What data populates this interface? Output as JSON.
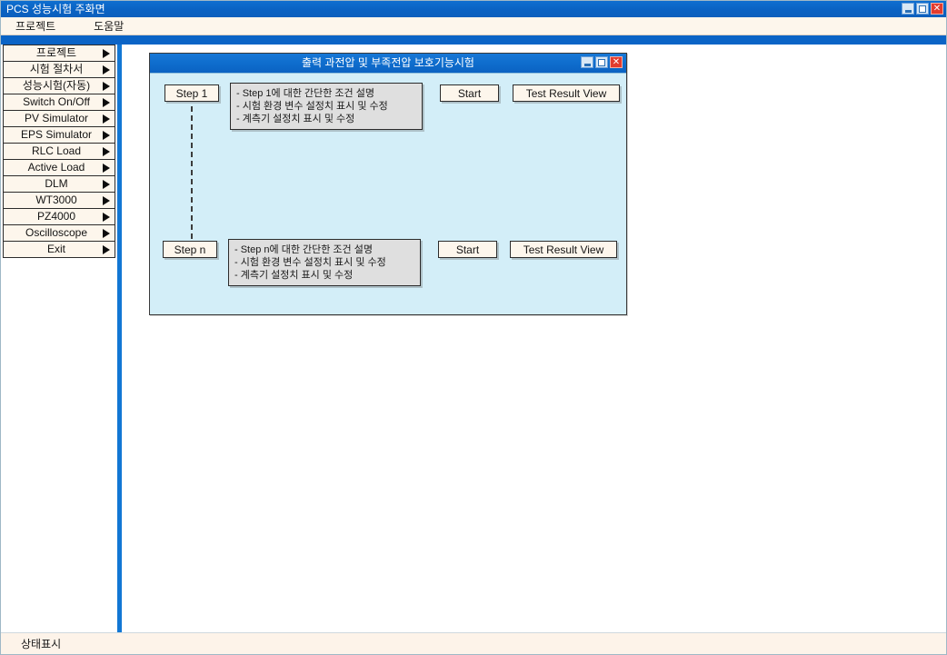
{
  "window": {
    "title": "PCS 성능시험 주화면",
    "controls": [
      {
        "name": "minimize",
        "glyph": "_"
      },
      {
        "name": "maximize",
        "glyph": "□"
      },
      {
        "name": "close",
        "glyph": "✕"
      }
    ]
  },
  "menubar": {
    "items": [
      {
        "label": "프로젝트"
      },
      {
        "label": "도움말"
      }
    ]
  },
  "sidebar": {
    "items": [
      {
        "label": "프로젝트",
        "arrow": "▶"
      },
      {
        "label": "시험 절차서",
        "arrow": "▶"
      },
      {
        "label": "성능시험(자동)",
        "arrow": "▶"
      },
      {
        "label": "Switch On/Off",
        "arrow": "▶"
      },
      {
        "label": "PV Simulator",
        "arrow": "▶"
      },
      {
        "label": "EPS Simulator",
        "arrow": "▶"
      },
      {
        "label": "RLC Load",
        "arrow": "▶"
      },
      {
        "label": "Active Load",
        "arrow": "▶"
      },
      {
        "label": "DLM",
        "arrow": "▶"
      },
      {
        "label": "WT3000",
        "arrow": "▶"
      },
      {
        "label": "PZ4000",
        "arrow": "▶"
      },
      {
        "label": "Oscilloscope",
        "arrow": "▶"
      },
      {
        "label": "Exit",
        "arrow": "▶"
      }
    ]
  },
  "dialog": {
    "title": "출력 과전압 및 부족전압 보호기능시험",
    "controls": [
      {
        "name": "minimize",
        "glyph": "_"
      },
      {
        "name": "maximize",
        "glyph": "□"
      },
      {
        "name": "close",
        "glyph": "✕"
      }
    ],
    "steps": [
      {
        "step_label": "Step 1",
        "description": [
          "- Step 1에 대한 간단한 조건 설명",
          "- 시험 환경 변수 설정치 표시 및 수정",
          "- 계측기 설정치 표시 및 수정"
        ],
        "start_label": "Start",
        "result_label": "Test Result View"
      },
      {
        "step_label": "Step n",
        "description": [
          "- Step n에 대한 간단한 조건 설명",
          "- 시험 환경 변수 설정치 표시 및 수정",
          "- 계측기 설정치 표시 및 수정"
        ],
        "start_label": "Start",
        "result_label": "Test Result View"
      }
    ]
  },
  "statusbar": {
    "text": "상태표시"
  },
  "colors": {
    "titlebar_blue": "#0b63c4",
    "dialog_body_blue": "#d3eef8",
    "button_cream": "#fdf6ec",
    "desc_gray": "#dfdfdf",
    "close_red": "#e33c2e",
    "sidebar_divider_blue": "#1277d4",
    "statusbar_cream": "#fdf3e9"
  }
}
